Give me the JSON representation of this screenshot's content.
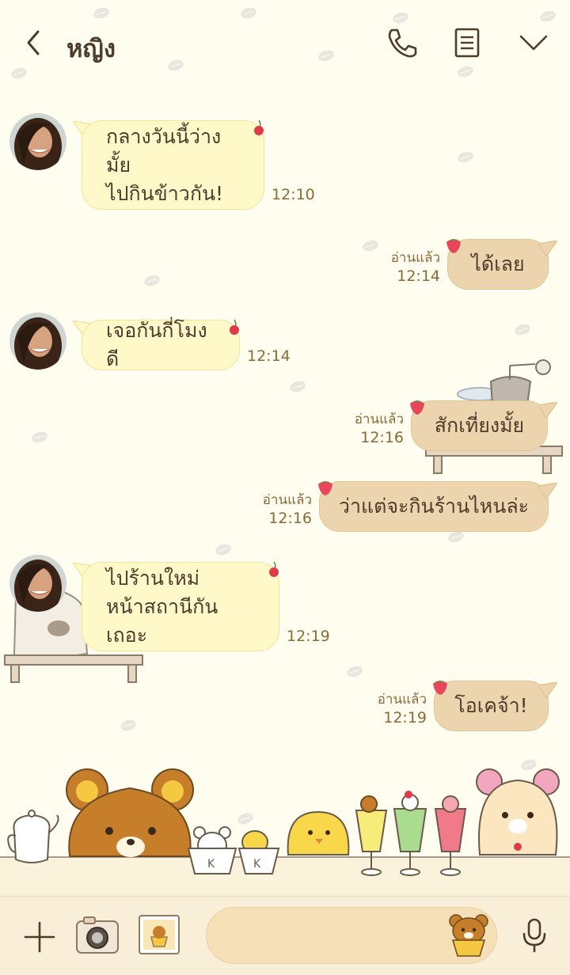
{
  "header": {
    "contact_name": "หญิง",
    "back_icon": "chevron-left-icon",
    "call_icon": "phone-icon",
    "notes_icon": "notes-icon",
    "menu_icon": "chevron-down-icon"
  },
  "messages": [
    {
      "side": "in",
      "text": "กลางวันนี้ว่างมั้ย\nไปกินข้าวกัน!",
      "time": "12:10"
    },
    {
      "side": "out",
      "text": "ได้เลย",
      "read": "อ่านแล้ว",
      "time": "12:14"
    },
    {
      "side": "in",
      "text": "เจอกันกี่โมงดี",
      "time": "12:14"
    },
    {
      "side": "out",
      "text": "สักเที่ยงมั้ย",
      "read": "อ่านแล้ว",
      "time": "12:16"
    },
    {
      "side": "out",
      "text": "ว่าแต่จะกินร้านไหนล่ะ",
      "read": "อ่านแล้ว",
      "time": "12:16"
    },
    {
      "side": "in",
      "text": "ไปร้านใหม่\nหน้าสถานีกันเถอะ",
      "time": "12:19"
    },
    {
      "side": "out",
      "text": "โอเคจ้า!",
      "read": "อ่านแล้ว",
      "time": "12:19"
    }
  ],
  "input": {
    "placeholder": ""
  },
  "bottom_bar": {
    "plus_icon": "plus-icon",
    "camera_icon": "camera-icon",
    "gallery_icon": "image-icon",
    "sticker_icon": "bear-sticker-icon",
    "mic_icon": "microphone-icon"
  },
  "colors": {
    "background": "#fffdf0",
    "incoming_bubble": "#fff9c9",
    "outgoing_bubble": "#ecd5ae",
    "text": "#4f3b2b",
    "meta_text": "#8b6a36",
    "bottom_bar": "#f9efd9"
  }
}
